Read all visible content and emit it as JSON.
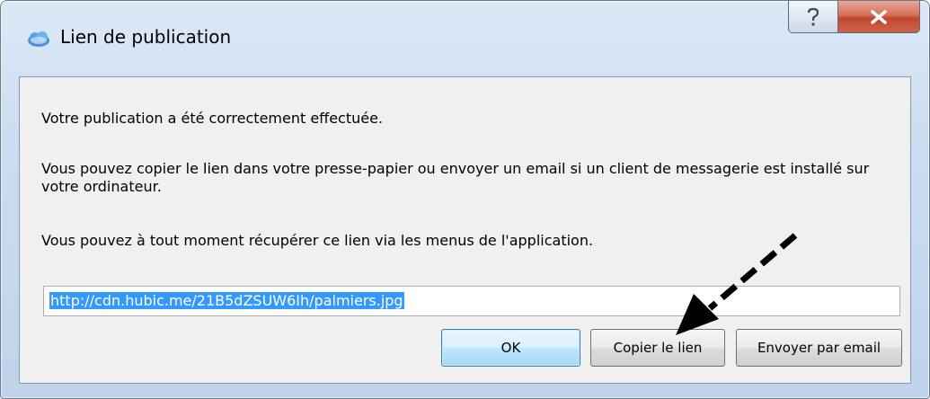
{
  "window": {
    "title": "Lien de publication",
    "help_label": "?",
    "close_label": "X"
  },
  "messages": {
    "success": "Votre publication a été correctement effectuée.",
    "copy_info": "Vous pouvez copier le lien dans votre presse-papier ou envoyer un email si un client de messagerie est installé sur votre ordinateur.",
    "retrieve_info": "Vous pouvez à tout moment récupérer ce lien via les menus de l'application."
  },
  "link": {
    "value": "http://cdn.hubic.me/21B5dZSUW6Ih/palmiers.jpg"
  },
  "buttons": {
    "ok": "OK",
    "copy": "Copier le lien",
    "email": "Envoyer par email"
  },
  "colors": {
    "selection": "#3399ff",
    "close_button": "#c0482e"
  },
  "icons": {
    "app": "hubic-cloud-icon",
    "help": "question-icon",
    "close": "close-icon"
  }
}
